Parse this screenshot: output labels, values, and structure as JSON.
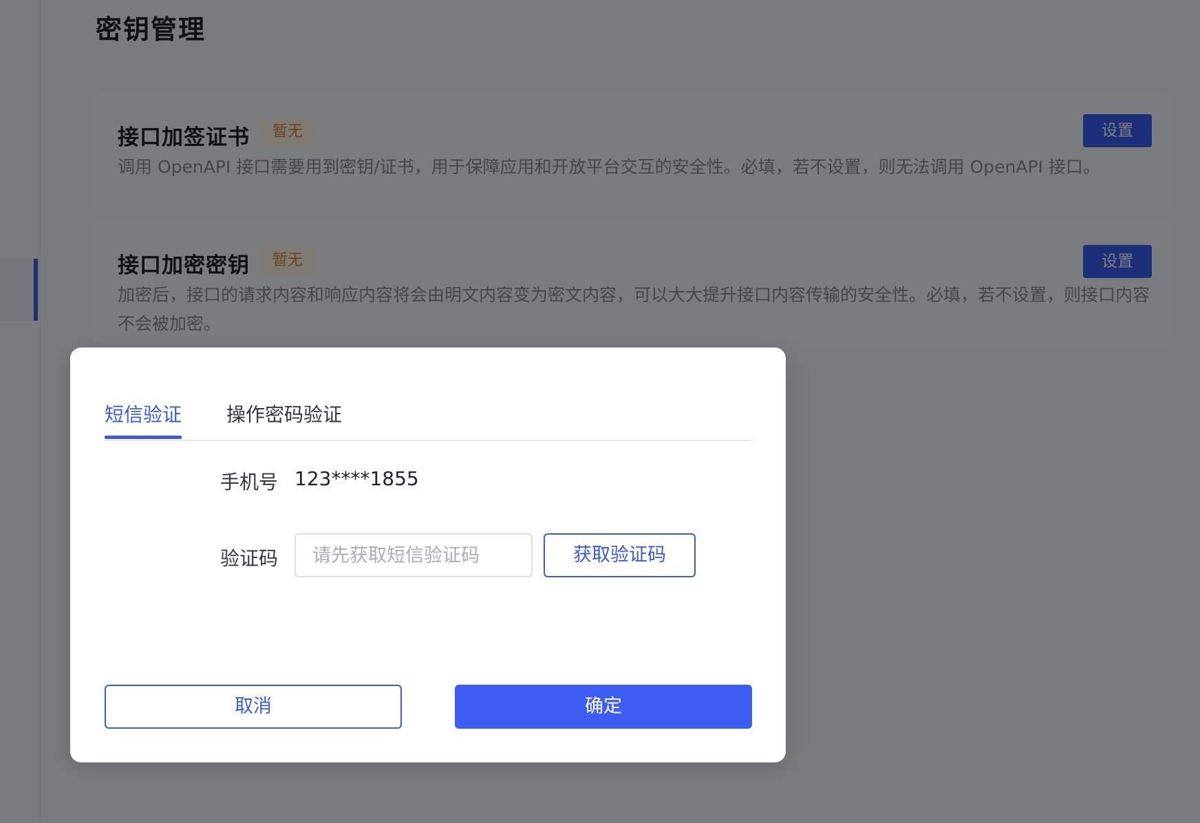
{
  "page": {
    "title": "密钥管理"
  },
  "cards": [
    {
      "title": "接口加签证书",
      "badge": "暂无",
      "description": "调用 OpenAPI 接口需要用到密钥/证书，用于保障应用和开放平台交互的安全性。必填，若不设置，则无法调用 OpenAPI 接口。",
      "button_label": "设置"
    },
    {
      "title": "接口加密密钥",
      "badge": "暂无",
      "description": "加密后，接口的请求内容和响应内容将会由明文内容变为密文内容，可以大大提升接口内容传输的安全性。必填，若不设置，则接口内容不会被加密。",
      "button_label": "设置"
    }
  ],
  "colors": {
    "accent": "#3b5bdb",
    "primary_button": "#3d5ef5",
    "badge_text": "#e0833a",
    "overlay": "rgba(0,0,0,0.5)"
  },
  "modal": {
    "tabs": [
      {
        "label": "短信验证",
        "active": true
      },
      {
        "label": "操作密码验证",
        "active": false
      }
    ],
    "phone": {
      "label": "手机号",
      "value": "123****1855"
    },
    "code": {
      "label": "验证码",
      "value": "",
      "placeholder": "请先获取短信验证码",
      "get_code_label": "获取验证码"
    },
    "cancel_label": "取消",
    "confirm_label": "确定"
  }
}
